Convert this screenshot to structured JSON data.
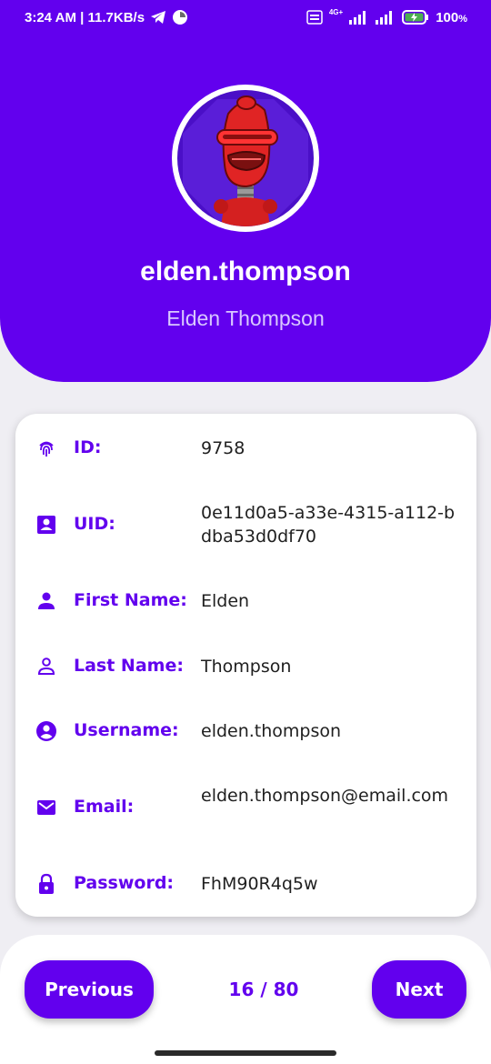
{
  "status_bar": {
    "time_speed": "3:24 AM | 11.7KB/s",
    "network": "4G+",
    "battery": "100"
  },
  "profile": {
    "username": "elden.thompson",
    "full_name": "Elden Thompson"
  },
  "fields": [
    {
      "label": "ID:",
      "value": "9758",
      "icon": "fingerprint-icon"
    },
    {
      "label": "UID:",
      "value": "0e11d0a5-a33e-4315-a112-bdba53d0df70",
      "icon": "id-card-icon"
    },
    {
      "label": "First Name:",
      "value": "Elden",
      "icon": "person-icon"
    },
    {
      "label": "Last Name:",
      "value": "Thompson",
      "icon": "person-outline-icon"
    },
    {
      "label": "Username:",
      "value": "elden.thompson",
      "icon": "account-circle-icon"
    },
    {
      "label": "Email:",
      "value": "elden.thompson@email.com",
      "icon": "mail-icon"
    },
    {
      "label": "Password:",
      "value": "FhM90R4q5w",
      "icon": "lock-icon"
    }
  ],
  "navigation": {
    "previous_label": "Previous",
    "next_label": "Next",
    "page_counter": "16 / 80"
  },
  "colors": {
    "primary": "#6200ee",
    "background": "#efeef3",
    "card": "#ffffff"
  }
}
